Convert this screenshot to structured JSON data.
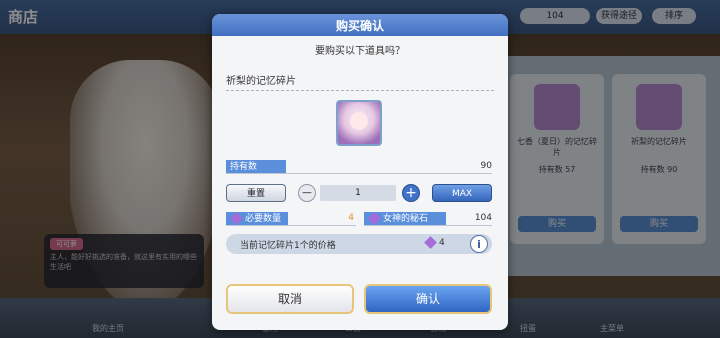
{
  "background": {
    "shop_title": "商店",
    "top_right": [
      "104",
      "获得途径",
      "排序"
    ],
    "speech_name": "可可萝",
    "speech_text": "主人，能好好挑选的准备，就这里有实用的哪些生活吧",
    "cards": [
      {
        "name": "七香（夏日）的记忆碎片",
        "owned": "持有数 57",
        "cost": "4",
        "buy": "购买"
      },
      {
        "name": "祈梨的记忆碎片",
        "owned": "持有数 90",
        "cost": "4",
        "buy": "购买"
      }
    ],
    "nav": [
      "我的主页",
      "冒险",
      "公会",
      "会战",
      "扭蛋",
      "主菜单"
    ]
  },
  "dialog": {
    "title": "购买确认",
    "question": "要购买以下道具吗？",
    "item_name": "祈梨的记忆碎片",
    "owned_label": "持有数",
    "owned_value": "90",
    "reset_label": "重置",
    "minus_label": "−",
    "quantity": "1",
    "plus_label": "+",
    "max_label": "MAX",
    "required_label": "必要数量",
    "required_value": "4",
    "currency_label": "女神的秘石",
    "currency_value": "104",
    "price_text": "当前记忆碎片1个的价格",
    "price_value": "4",
    "info_label": "i",
    "cancel_label": "取消",
    "confirm_label": "确认"
  },
  "colors": {
    "header": "#4170c2",
    "accent": "#5b8fdc",
    "required_value": "#d9922a",
    "gem": "#a46cd8"
  }
}
